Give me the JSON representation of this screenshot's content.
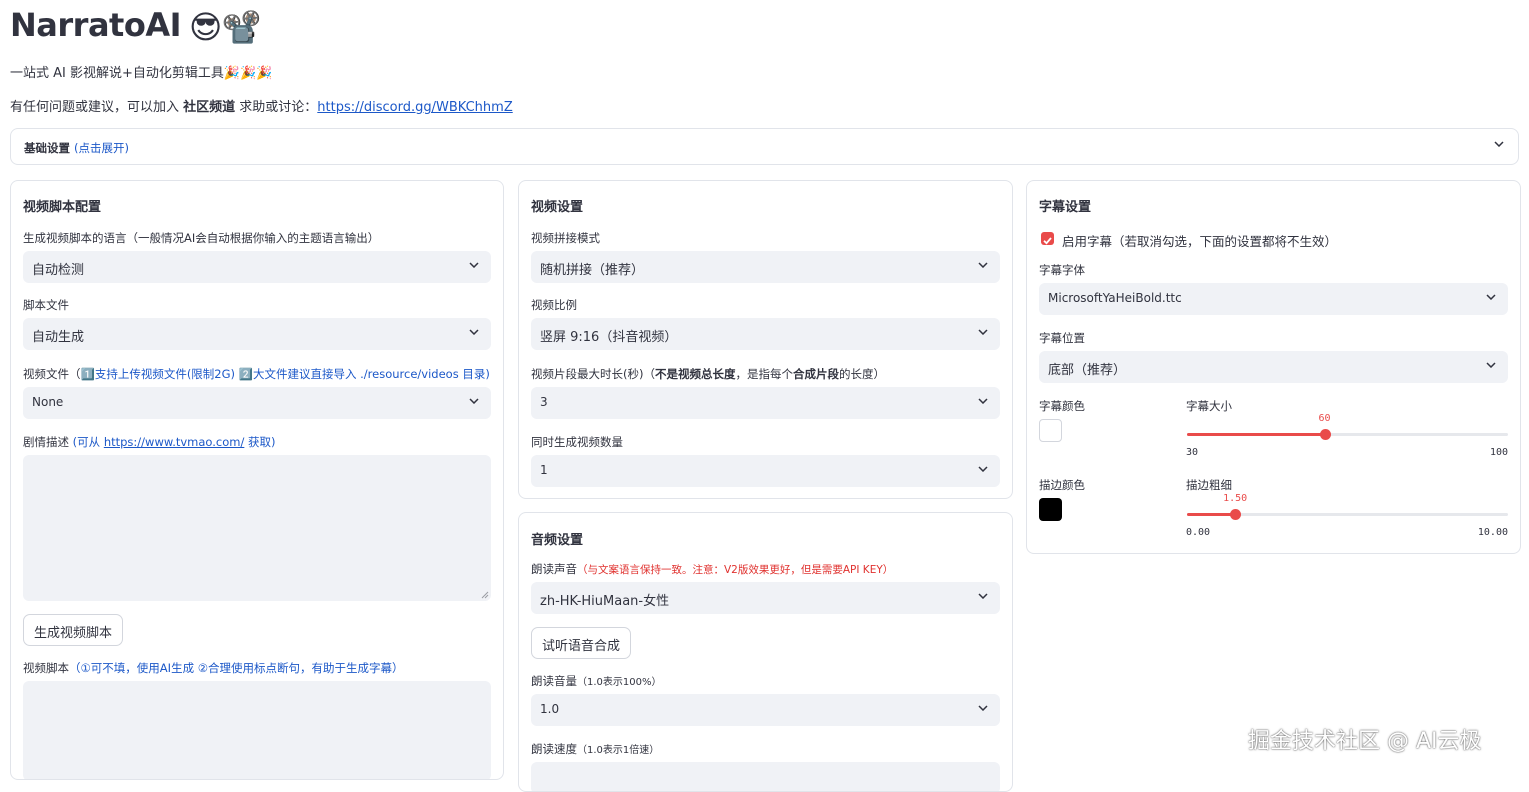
{
  "header": {
    "title": "NarratoAI",
    "title_emoji": "😎📽️",
    "subtitle": "一站式 AI 影视解说+自动化剪辑工具🎉🎉🎉",
    "community_prefix": "有任何问题或建议，可以加入 ",
    "community_bold": "社区频道",
    "community_mid": " 求助或讨论：",
    "community_link": "https://discord.gg/WBKChhmZ"
  },
  "basic_settings": {
    "label": "基础设置",
    "hint": "(点击展开)"
  },
  "script_panel": {
    "title": "视频脚本配置",
    "language_label": "生成视频脚本的语言（一般情况AI会自动根据你输入的主题语言输出）",
    "language_value": "自动检测",
    "script_file_label": "脚本文件",
    "script_file_value": "自动生成",
    "video_file_label": "视频文件（",
    "video_file_hint": "1️⃣支持上传视频文件(限制2G) 2️⃣大文件建议直接导入 ./resource/videos 目录)",
    "video_file_value": "None",
    "plot_label": "剧情描述 ",
    "plot_hint_prefix": "(可从 ",
    "plot_hint_link": "https://www.tvmao.com/",
    "plot_hint_suffix": " 获取)",
    "plot_value": "",
    "generate_button": "生成视频脚本",
    "video_script_label": "视频脚本",
    "video_script_hint": "（①可不填，使用AI生成 ②合理使用标点断句，有助于生成字幕）",
    "video_script_value": ""
  },
  "video_panel": {
    "title": "视频设置",
    "concat_label": "视频拼接模式",
    "concat_value": "随机拼接（推荐）",
    "ratio_label": "视频比例",
    "ratio_value": "竖屏 9:16（抖音视频）",
    "clip_label_prefix": "视频片段最大时长(秒)（",
    "clip_label_bold1": "不是视频总长度",
    "clip_label_mid": "，是指每个",
    "clip_label_bold2": "合成片段",
    "clip_label_suffix": "的长度）",
    "clip_value": "3",
    "count_label": "同时生成视频数量",
    "count_value": "1"
  },
  "audio_panel": {
    "title": "音频设置",
    "voice_label": "朗读声音",
    "voice_hint": "（与文案语言保持一致。注意：V2版效果更好，但是需要API KEY）",
    "voice_value": "zh-HK-HiuMaan-女性",
    "listen_button": "试听语音合成",
    "volume_label": "朗读音量",
    "volume_hint": "（1.0表示100%）",
    "volume_value": "1.0",
    "speed_label": "朗读速度",
    "speed_hint": "（1.0表示1倍速）"
  },
  "subtitle_panel": {
    "title": "字幕设置",
    "enable_label": "启用字幕（若取消勾选，下面的设置都将不生效）",
    "enabled": true,
    "font_label": "字幕字体",
    "font_value": "MicrosoftYaHeiBold.ttc",
    "position_label": "字幕位置",
    "position_value": "底部（推荐）",
    "color_label": "字幕颜色",
    "color_value": "#FFFFFF",
    "size_label": "字幕大小",
    "size": {
      "value": "60",
      "min": "30",
      "max": "100",
      "num": 60,
      "lo": 30,
      "hi": 100
    },
    "stroke_color_label": "描边颜色",
    "stroke_color_value": "#000000",
    "stroke_width_label": "描边粗细",
    "stroke": {
      "value": "1.50",
      "min": "0.00",
      "max": "10.00",
      "num": 1.5,
      "lo": 0,
      "hi": 10
    }
  },
  "watermark": "掘金技术社区 @ AI云极",
  "colors": {
    "accent": "#E94B4A",
    "link": "#1C58C8",
    "warning": "#E0322F",
    "field_bg": "#F0F2F6",
    "border": "#E1E4EA"
  }
}
